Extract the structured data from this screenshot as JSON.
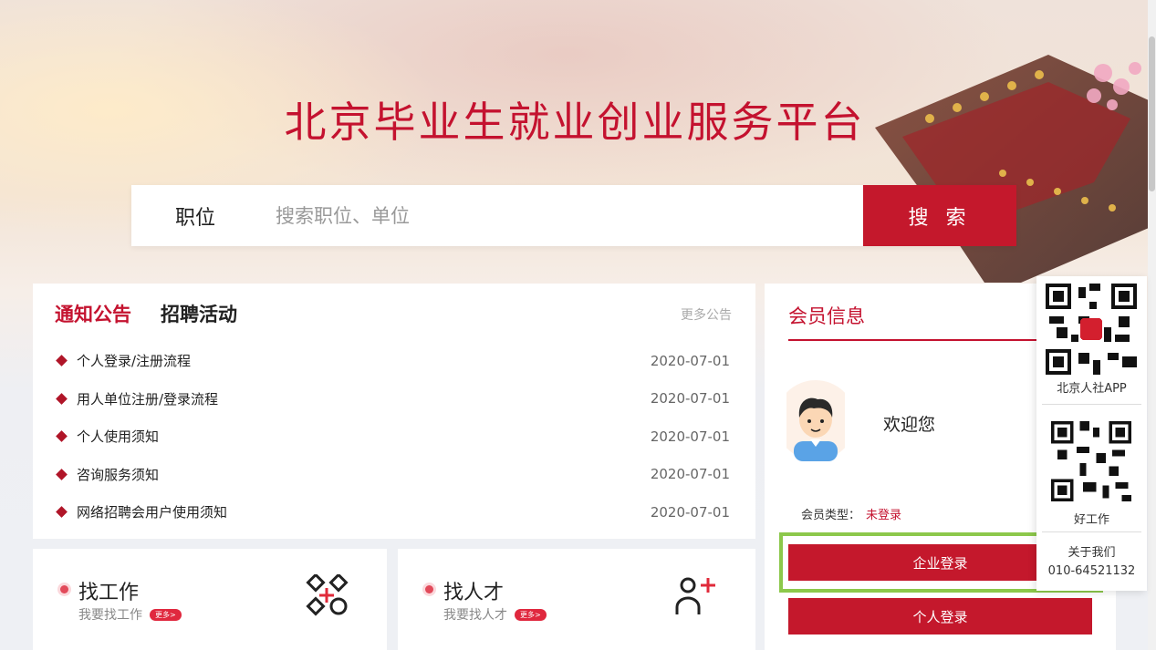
{
  "site": {
    "title": "北京毕业生就业创业服务平台"
  },
  "search": {
    "type_label": "职位",
    "placeholder": "搜索职位、单位",
    "button_label": "搜 索"
  },
  "notices": {
    "tabs": [
      {
        "label": "通知公告",
        "active": true
      },
      {
        "label": "招聘活动",
        "active": false
      }
    ],
    "more_label": "更多公告",
    "items": [
      {
        "title": "个人登录/注册流程",
        "date": "2020-07-01"
      },
      {
        "title": "用人单位注册/登录流程",
        "date": "2020-07-01"
      },
      {
        "title": "个人使用须知",
        "date": "2020-07-01"
      },
      {
        "title": "咨询服务须知",
        "date": "2020-07-01"
      },
      {
        "title": "网络招聘会用户使用须知",
        "date": "2020-07-01"
      }
    ]
  },
  "features": [
    {
      "title": "找工作",
      "subtitle": "我要找工作",
      "badge": "更多>",
      "icon": "job-search-icon"
    },
    {
      "title": "找人才",
      "subtitle": "我要找人才",
      "badge": "更多>",
      "icon": "add-person-icon"
    }
  ],
  "member": {
    "title": "会员信息",
    "welcome": "欢迎您",
    "type_label": "会员类型：",
    "type_value": "未登录",
    "enterprise_login": "企业登录",
    "personal_login": "个人登录"
  },
  "float_panel": {
    "app_label": "北京人社APP",
    "job_label": "好工作",
    "about_label": "关于我们",
    "phone": "010-64521132"
  },
  "colors": {
    "brand_red": "#c4122f",
    "highlight_green": "#8cc84b"
  }
}
